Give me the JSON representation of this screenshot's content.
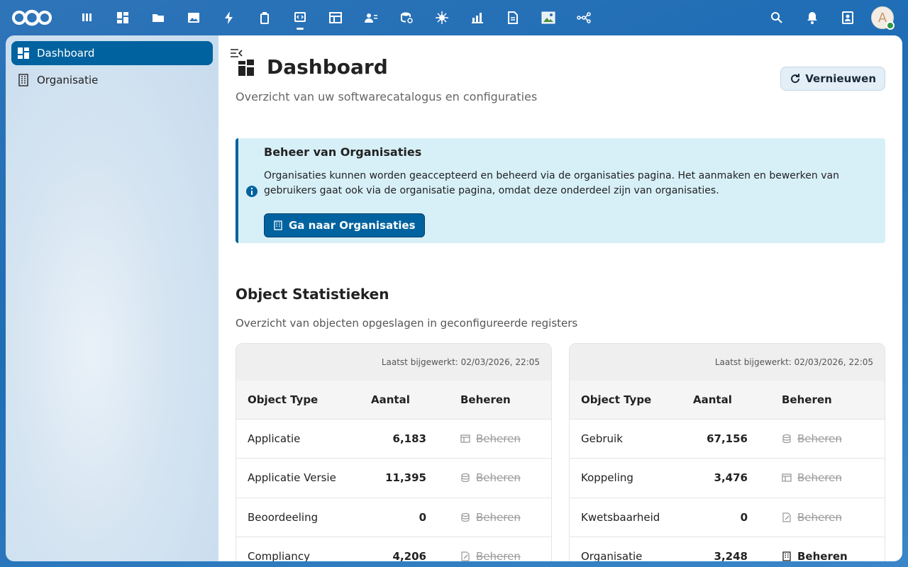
{
  "topbar": {
    "apps": [
      {
        "icon": "deck-icon"
      },
      {
        "icon": "dashboard-icon"
      },
      {
        "icon": "files-icon"
      },
      {
        "icon": "photos-icon"
      },
      {
        "icon": "activity-icon"
      },
      {
        "icon": "trash-icon"
      },
      {
        "icon": "softwarecatalog-icon",
        "active": true
      },
      {
        "icon": "tables-icon"
      },
      {
        "icon": "contacts-icon"
      },
      {
        "icon": "database-icon"
      },
      {
        "icon": "settings-bug-icon"
      },
      {
        "icon": "chart-icon"
      },
      {
        "icon": "document-icon"
      },
      {
        "icon": "image-icon"
      },
      {
        "icon": "flow-icon"
      }
    ],
    "avatar_letter": "A"
  },
  "sidebar": {
    "items": [
      {
        "label": "Dashboard",
        "icon": "dashboard-icon",
        "active": true
      },
      {
        "label": "Organisatie",
        "icon": "building-icon",
        "active": false
      }
    ]
  },
  "header": {
    "title": "Dashboard",
    "subtitle": "Overzicht van uw softwarecatalogus en configuraties",
    "refresh_label": "Vernieuwen"
  },
  "info": {
    "title": "Beheer van Organisaties",
    "text": "Organisaties kunnen worden geaccepteerd en beheerd via de organisaties pagina. Het aanmaken en bewerken van gebruikers gaat ook via de organisatie pagina, omdat deze onderdeel zijn van organisaties.",
    "button_label": "Ga naar Organisaties"
  },
  "stats": {
    "title": "Object Statistieken",
    "subtitle": "Overzicht van objecten opgeslagen in geconfigureerde registers",
    "columns": {
      "type": "Object Type",
      "count": "Aantal",
      "manage": "Beheren"
    },
    "left": {
      "updated": "Laatst bijgewerkt: 02/03/2026, 22:05",
      "rows": [
        {
          "type": "Applicatie",
          "count": "6,183",
          "manage": "Beheren",
          "icon": "tables-icon",
          "enabled": false
        },
        {
          "type": "Applicatie Versie",
          "count": "11,395",
          "manage": "Beheren",
          "icon": "database-icon",
          "enabled": false
        },
        {
          "type": "Beoordeeling",
          "count": "0",
          "manage": "Beheren",
          "icon": "database-icon",
          "enabled": false
        },
        {
          "type": "Compliancy",
          "count": "4,206",
          "manage": "Beheren",
          "icon": "document-edit-icon",
          "enabled": false
        }
      ]
    },
    "right": {
      "updated": "Laatst bijgewerkt: 02/03/2026, 22:05",
      "rows": [
        {
          "type": "Gebruik",
          "count": "67,156",
          "manage": "Beheren",
          "icon": "database-icon",
          "enabled": false
        },
        {
          "type": "Koppeling",
          "count": "3,476",
          "manage": "Beheren",
          "icon": "tables-icon",
          "enabled": false
        },
        {
          "type": "Kwetsbaarheid",
          "count": "0",
          "manage": "Beheren",
          "icon": "document-edit-icon",
          "enabled": false
        },
        {
          "type": "Organisatie",
          "count": "3,248",
          "manage": "Beheren",
          "icon": "building-icon",
          "enabled": true
        }
      ]
    }
  }
}
